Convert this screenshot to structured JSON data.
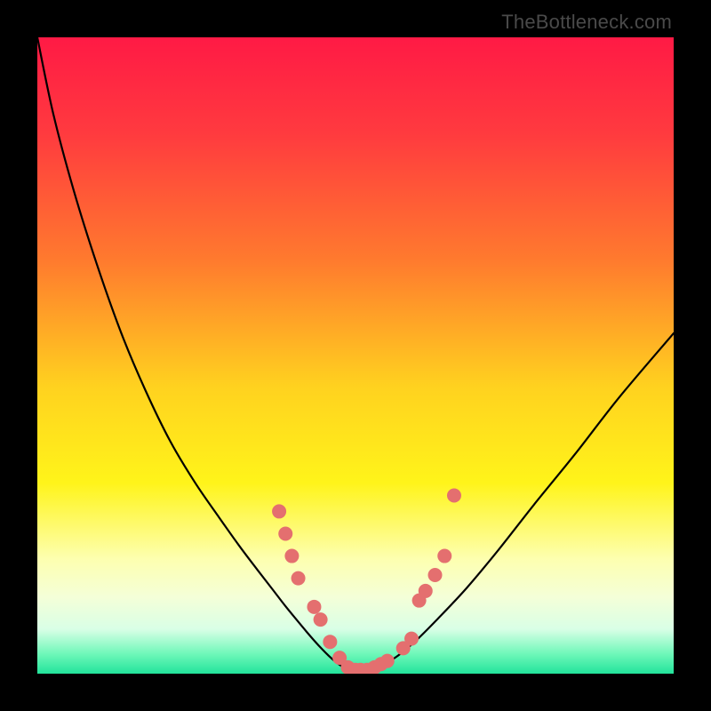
{
  "watermark": {
    "text": "TheBottleneck.com"
  },
  "chart_data": {
    "type": "line",
    "title": "",
    "xlabel": "",
    "ylabel": "",
    "xlim": [
      0,
      100
    ],
    "ylim": [
      0,
      100
    ],
    "gradient_stops": [
      {
        "offset": 0,
        "color": "#ff1a45"
      },
      {
        "offset": 0.15,
        "color": "#ff3a3f"
      },
      {
        "offset": 0.35,
        "color": "#ff7a2e"
      },
      {
        "offset": 0.55,
        "color": "#ffd21f"
      },
      {
        "offset": 0.7,
        "color": "#fff41a"
      },
      {
        "offset": 0.82,
        "color": "#fdffb0"
      },
      {
        "offset": 0.88,
        "color": "#f4ffd8"
      },
      {
        "offset": 0.93,
        "color": "#d9ffe6"
      },
      {
        "offset": 0.97,
        "color": "#6cf7b8"
      },
      {
        "offset": 1.0,
        "color": "#22e39b"
      }
    ],
    "series": [
      {
        "name": "bottleneck-curve",
        "x": [
          0.0,
          2.5,
          5.7,
          9.3,
          13.2,
          17.0,
          20.9,
          24.8,
          28.6,
          31.8,
          34.6,
          37.0,
          39.0,
          40.8,
          42.3,
          43.6,
          44.8,
          45.8,
          46.7,
          47.5,
          48.3,
          49.1,
          52.0,
          54.0,
          56.5,
          59.5,
          63.0,
          67.5,
          72.5,
          78.0,
          84.5,
          91.5,
          100.0
        ],
        "y": [
          100.0,
          88.0,
          76.0,
          64.5,
          53.5,
          44.5,
          36.5,
          30.0,
          24.5,
          20.0,
          16.3,
          13.2,
          10.6,
          8.4,
          6.6,
          5.1,
          3.8,
          2.8,
          2.0,
          1.4,
          0.85,
          0.55,
          0.55,
          1.2,
          2.7,
          5.2,
          8.7,
          13.5,
          19.5,
          26.5,
          34.5,
          43.5,
          53.5
        ]
      }
    ],
    "markers": {
      "name": "data-points",
      "color": "#e46f6f",
      "radius_px": 8,
      "points": [
        {
          "x": 38.0,
          "y": 25.5
        },
        {
          "x": 39.0,
          "y": 22.0
        },
        {
          "x": 40.0,
          "y": 18.5
        },
        {
          "x": 41.0,
          "y": 15.0
        },
        {
          "x": 43.5,
          "y": 10.5
        },
        {
          "x": 44.5,
          "y": 8.5
        },
        {
          "x": 46.0,
          "y": 5.0
        },
        {
          "x": 47.5,
          "y": 2.5
        },
        {
          "x": 48.8,
          "y": 1.0
        },
        {
          "x": 50.0,
          "y": 0.6
        },
        {
          "x": 50.8,
          "y": 0.6
        },
        {
          "x": 51.8,
          "y": 0.6
        },
        {
          "x": 53.0,
          "y": 1.0
        },
        {
          "x": 54.0,
          "y": 1.5
        },
        {
          "x": 55.0,
          "y": 2.0
        },
        {
          "x": 57.5,
          "y": 4.0
        },
        {
          "x": 58.8,
          "y": 5.5
        },
        {
          "x": 60.0,
          "y": 11.5
        },
        {
          "x": 61.0,
          "y": 13.0
        },
        {
          "x": 62.5,
          "y": 15.5
        },
        {
          "x": 64.0,
          "y": 18.5
        },
        {
          "x": 65.5,
          "y": 28.0
        }
      ]
    }
  }
}
